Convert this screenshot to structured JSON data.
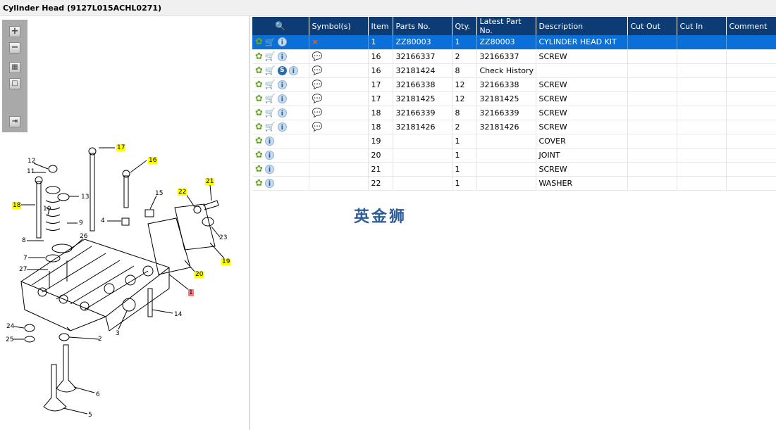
{
  "title": "Cylinder Head (9127L015ACHL0271)",
  "toolbar": {
    "zoom_in": "+",
    "zoom_out": "−",
    "fit": "▦",
    "actual": "□",
    "layout": "⇥"
  },
  "columns": [
    "",
    "Symbol(s)",
    "Item",
    "Parts No.",
    "Qty.",
    "Latest Part No.",
    "Description",
    "Cut Out",
    "Cut In",
    "Comment"
  ],
  "rows": [
    {
      "item": "1",
      "part": "ZZ80003",
      "qty": "1",
      "latest": "ZZ80003",
      "desc": "CYLINDER HEAD KIT",
      "symbol": "×",
      "cart": true,
      "s": false,
      "selected": true
    },
    {
      "item": "16",
      "part": "32166337",
      "qty": "2",
      "latest": "32166337",
      "desc": "SCREW",
      "symbol": "💬",
      "cart": true,
      "s": false
    },
    {
      "item": "16",
      "part": "32181424",
      "qty": "8",
      "latest": "Check History",
      "desc": "",
      "symbol": "💬",
      "cart": true,
      "s": true
    },
    {
      "item": "17",
      "part": "32166338",
      "qty": "12",
      "latest": "32166338",
      "desc": "SCREW",
      "symbol": "💬",
      "cart": true,
      "s": false
    },
    {
      "item": "17",
      "part": "32181425",
      "qty": "12",
      "latest": "32181425",
      "desc": "SCREW",
      "symbol": "💬",
      "cart": true,
      "s": false
    },
    {
      "item": "18",
      "part": "32166339",
      "qty": "8",
      "latest": "32166339",
      "desc": "SCREW",
      "symbol": "💬",
      "cart": true,
      "s": false
    },
    {
      "item": "18",
      "part": "32181426",
      "qty": "2",
      "latest": "32181426",
      "desc": "SCREW",
      "symbol": "💬",
      "cart": true,
      "s": false
    },
    {
      "item": "19",
      "part": "",
      "qty": "1",
      "latest": "",
      "desc": "COVER",
      "symbol": "",
      "cart": false,
      "s": false
    },
    {
      "item": "20",
      "part": "",
      "qty": "1",
      "latest": "",
      "desc": "JOINT",
      "symbol": "",
      "cart": false,
      "s": false
    },
    {
      "item": "21",
      "part": "",
      "qty": "1",
      "latest": "",
      "desc": "SCREW",
      "symbol": "",
      "cart": false,
      "s": false
    },
    {
      "item": "22",
      "part": "",
      "qty": "1",
      "latest": "",
      "desc": "WASHER",
      "symbol": "",
      "cart": false,
      "s": false
    }
  ],
  "watermark": "英金狮",
  "callouts": [
    {
      "t": "17",
      "c": "y"
    },
    {
      "t": "16",
      "c": "y"
    },
    {
      "t": "12",
      "c": ""
    },
    {
      "t": "11",
      "c": ""
    },
    {
      "t": "13",
      "c": ""
    },
    {
      "t": "18",
      "c": "y"
    },
    {
      "t": "10",
      "c": ""
    },
    {
      "t": "9",
      "c": ""
    },
    {
      "t": "15",
      "c": ""
    },
    {
      "t": "22",
      "c": "y"
    },
    {
      "t": "21",
      "c": "y"
    },
    {
      "t": "4",
      "c": ""
    },
    {
      "t": "26",
      "c": ""
    },
    {
      "t": "8",
      "c": ""
    },
    {
      "t": "23",
      "c": ""
    },
    {
      "t": "7",
      "c": ""
    },
    {
      "t": "19",
      "c": "y"
    },
    {
      "t": "27",
      "c": ""
    },
    {
      "t": "20",
      "c": "y"
    },
    {
      "t": "1",
      "c": "r"
    },
    {
      "t": "14",
      "c": ""
    },
    {
      "t": "24",
      "c": ""
    },
    {
      "t": "3",
      "c": ""
    },
    {
      "t": "2",
      "c": ""
    },
    {
      "t": "25",
      "c": ""
    },
    {
      "t": "6",
      "c": ""
    },
    {
      "t": "5",
      "c": ""
    }
  ]
}
